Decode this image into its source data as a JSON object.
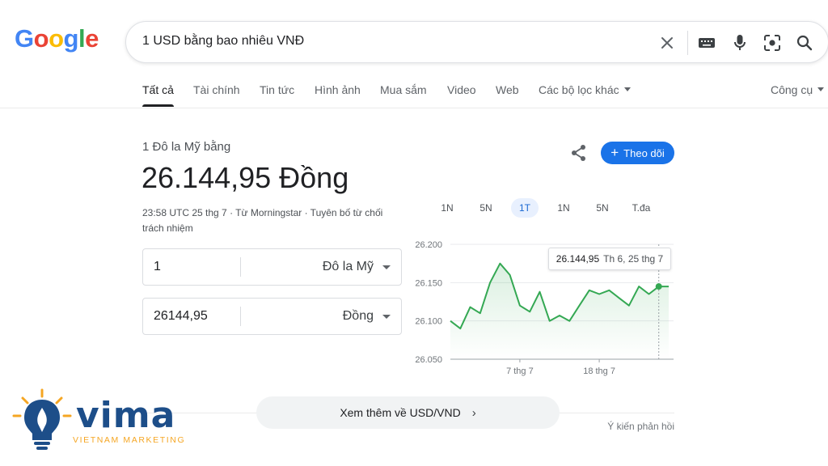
{
  "logo": {
    "letters": [
      "G",
      "o",
      "o",
      "g",
      "l",
      "e"
    ],
    "colors": [
      "#4285f4",
      "#ea4335",
      "#fbbc05",
      "#4285f4",
      "#34a853",
      "#ea4335"
    ]
  },
  "search": {
    "query": "1 USD bằng bao nhiêu VNĐ",
    "icons": [
      "close-icon",
      "keyboard-icon",
      "microphone-icon",
      "lens-icon",
      "search-icon"
    ]
  },
  "tabs": [
    {
      "label": "Tất cả",
      "active": true
    },
    {
      "label": "Tài chính"
    },
    {
      "label": "Tin tức"
    },
    {
      "label": "Hình ảnh"
    },
    {
      "label": "Mua sắm"
    },
    {
      "label": "Video"
    },
    {
      "label": "Web"
    },
    {
      "label": "Các bộ lọc khác",
      "dropdown": true
    }
  ],
  "tools": {
    "label": "Công cụ"
  },
  "converter": {
    "subtitle": "1 Đô la Mỹ bằng",
    "value": "26.144,95 Đồng",
    "meta": "23:58 UTC 25 thg 7 · Từ Morningstar · Tuyên bố từ chối trách nhiệm",
    "from": {
      "amount": "1",
      "unit": "Đô la Mỹ"
    },
    "to": {
      "amount": "26144,95",
      "unit": "Đồng"
    },
    "follow_label": "Theo dõi",
    "accent": "#1a73e8"
  },
  "ranges": [
    {
      "label": "1N"
    },
    {
      "label": "5N"
    },
    {
      "label": "1T",
      "active": true
    },
    {
      "label": "1N"
    },
    {
      "label": "5N"
    },
    {
      "label": "T.đa"
    }
  ],
  "tooltip": {
    "value": "26.144,95",
    "date": "Th 6, 25 thg 7"
  },
  "chart_data": {
    "type": "area",
    "color": "#34a853",
    "ylim": [
      26050,
      26200
    ],
    "ytick_values": [
      26200,
      26150,
      26100,
      26050
    ],
    "yticks": [
      "26.200",
      "26.150",
      "26.100",
      "26.050"
    ],
    "xticks": [
      {
        "label": "7 thg 7",
        "index": 7
      },
      {
        "label": "18 thg 7",
        "index": 15
      }
    ],
    "values": [
      26100,
      26090,
      26118,
      26110,
      26150,
      26175,
      26160,
      26120,
      26112,
      26138,
      26100,
      26107,
      26100,
      26120,
      26140,
      26135,
      26140,
      26130,
      26120,
      26145,
      26135,
      26145,
      26144.95
    ],
    "grid": true
  },
  "more": {
    "label": "Xem thêm về USD/VND"
  },
  "feedback": {
    "label": "Ý kiến phản hồi"
  },
  "watermark": {
    "word": "vima",
    "tagline": "VIETNAM MARKETING",
    "colors": [
      "#1d4e89",
      "#f5a623"
    ]
  }
}
